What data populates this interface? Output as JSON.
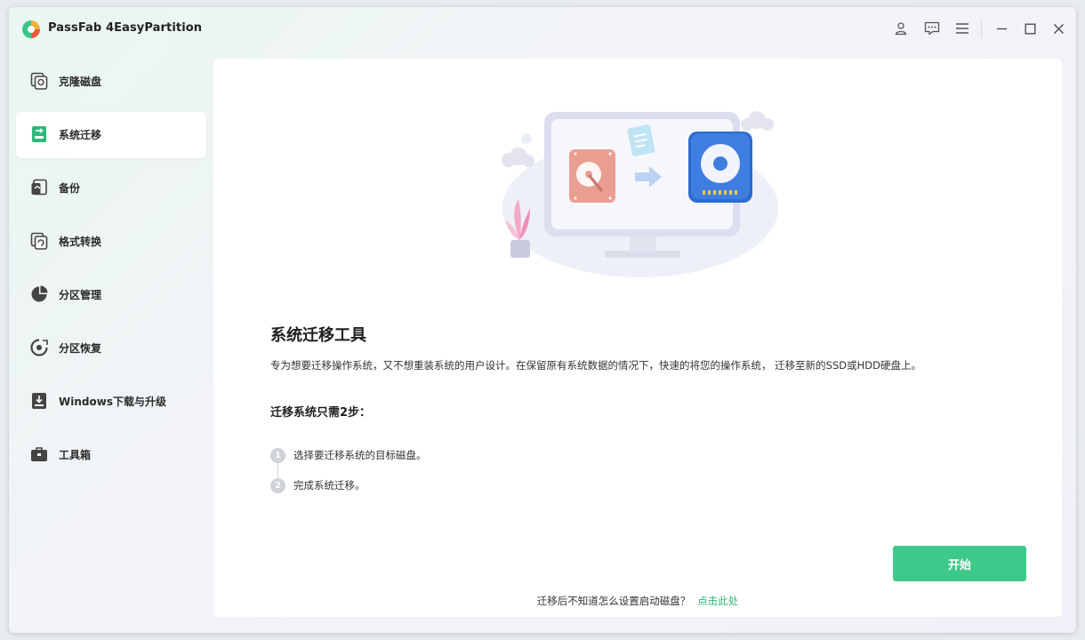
{
  "app": {
    "title": "PassFab 4EasyPartition"
  },
  "titlebar": {
    "icons": [
      "user-icon",
      "feedback-icon",
      "menu-icon",
      "minimize-icon",
      "maximize-icon",
      "close-icon"
    ]
  },
  "sidebar": {
    "items": [
      {
        "label": "克隆磁盘",
        "icon": "clone-disk-icon",
        "active": false
      },
      {
        "label": "系统迁移",
        "icon": "system-migration-icon",
        "active": true
      },
      {
        "label": "备份",
        "icon": "backup-icon",
        "active": false
      },
      {
        "label": "格式转换",
        "icon": "format-convert-icon",
        "active": false
      },
      {
        "label": "分区管理",
        "icon": "partition-manage-icon",
        "active": false
      },
      {
        "label": "分区恢复",
        "icon": "partition-recovery-icon",
        "active": false
      },
      {
        "label": "Windows下载与升级",
        "icon": "windows-download-icon",
        "active": false
      },
      {
        "label": "工具箱",
        "icon": "toolbox-icon",
        "active": false
      }
    ]
  },
  "main": {
    "title": "系统迁移工具",
    "description": "专为想要迁移操作系统，又不想重装系统的用户设计。在保留原有系统数据的情况下，快速的将您的操作系统， 迁移至新的SSD或HDD硬盘上。",
    "steps_title": "迁移系统只需2步：",
    "steps": [
      {
        "num": "1",
        "text": "选择要迁移系统的目标磁盘。"
      },
      {
        "num": "2",
        "text": "完成系统迁移。"
      }
    ],
    "start_button": "开始",
    "footer_text": "迁移后不知道怎么设置启动磁盘？",
    "footer_link": "点击此处"
  },
  "colors": {
    "accent": "#3dc98a",
    "link": "#2fb877",
    "disk_blue": "#3f7de0",
    "disk_red": "#ea9e92"
  }
}
